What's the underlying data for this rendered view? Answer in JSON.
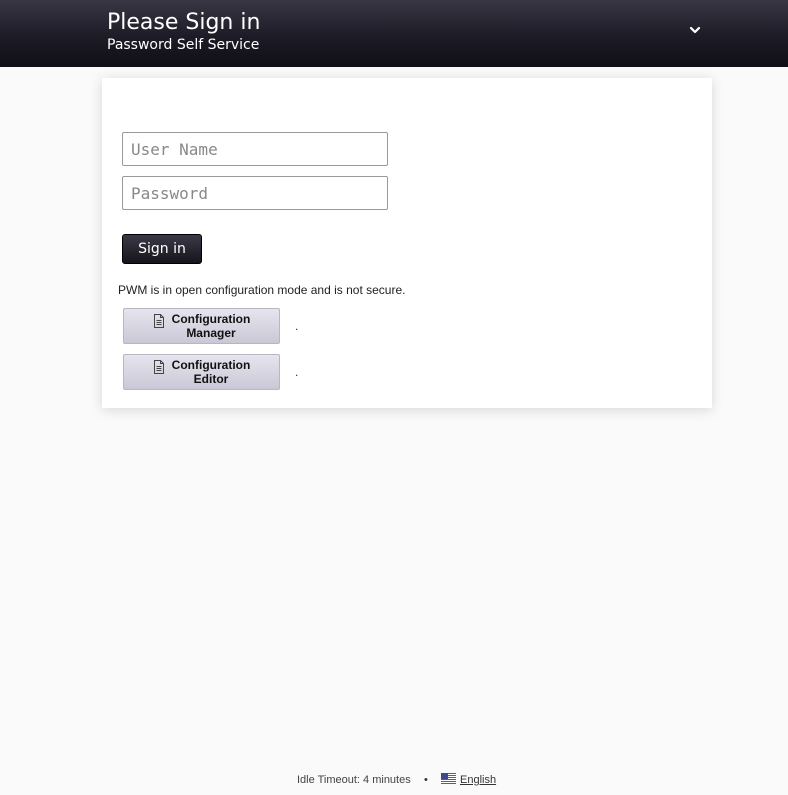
{
  "header": {
    "title": "Please Sign in",
    "subtitle": "Password Self Service",
    "menu_icon": "chevron-down-icon"
  },
  "login": {
    "username_placeholder": "User Name",
    "username_value": "",
    "password_placeholder": "Password",
    "password_value": "",
    "sign_in_label": "Sign in"
  },
  "config": {
    "notice": "PWM is in open configuration mode and is not secure.",
    "buttons": [
      {
        "line1": "Configuration",
        "line2": "Manager",
        "icon": "document-icon",
        "trailing": "."
      },
      {
        "line1": "Configuration",
        "line2": "Editor",
        "icon": "document-icon",
        "trailing": "."
      }
    ]
  },
  "footer": {
    "idle_timeout": "Idle Timeout: 4 minutes",
    "separator": "•",
    "language_flag": "us-flag-icon",
    "language": "English"
  },
  "colors": {
    "header_dark": "#1d1b26",
    "background": "#fafafa",
    "button_light": "#d8d6e2"
  }
}
